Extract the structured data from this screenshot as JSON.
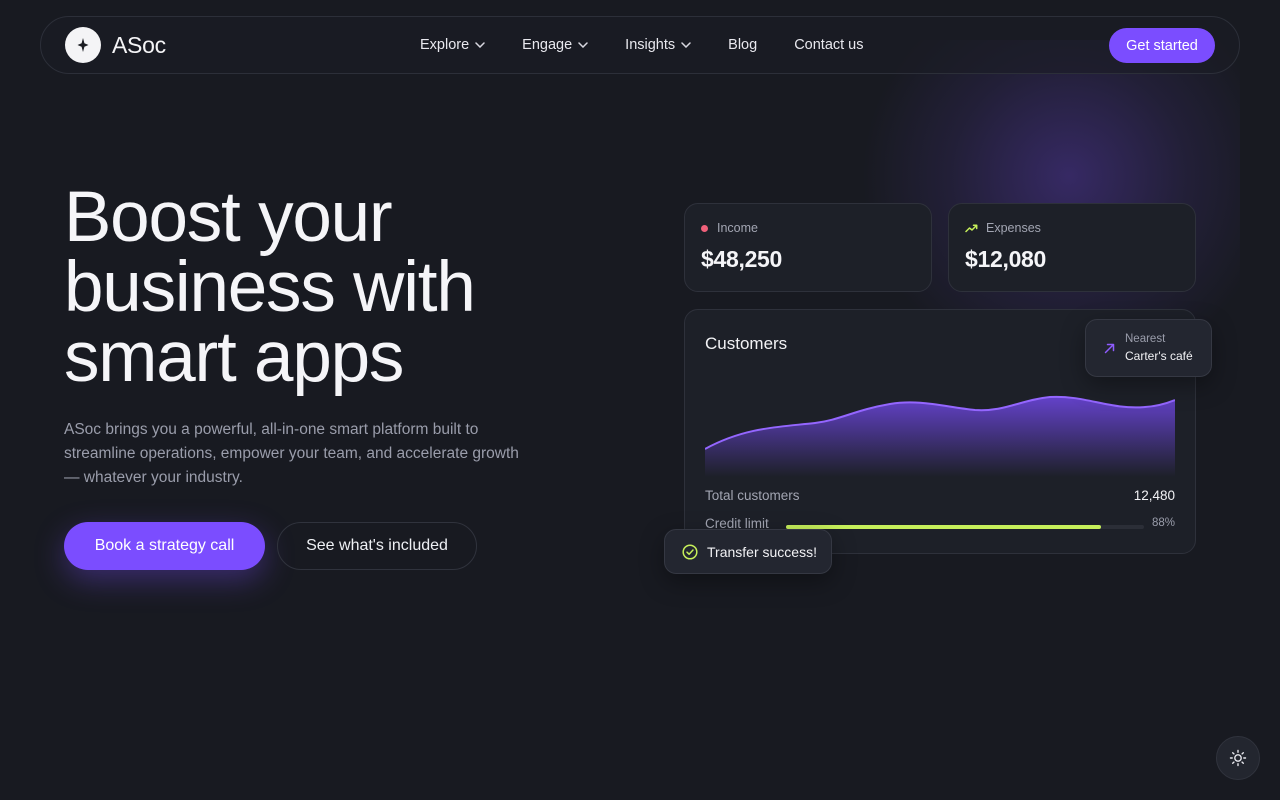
{
  "nav": {
    "brand": "ASoc",
    "links": [
      {
        "label": "Explore",
        "has_dropdown": true
      },
      {
        "label": "Engage",
        "has_dropdown": true
      },
      {
        "label": "Insights",
        "has_dropdown": true
      },
      {
        "label": "Blog",
        "has_dropdown": false
      },
      {
        "label": "Contact us",
        "has_dropdown": false
      }
    ],
    "cta": "Get started"
  },
  "hero": {
    "title_lines": [
      "Boost your",
      "business with",
      "smart apps"
    ],
    "description": "ASoc brings you a powerful, all-in-one smart platform built to streamline operations, empower your team, and accelerate growth — whatever your industry.",
    "primary_button": "Book a strategy call",
    "secondary_button": "See what's included"
  },
  "dashboard": {
    "income": {
      "label": "Income",
      "value": "$48,250"
    },
    "expenses": {
      "label": "Expenses",
      "value": "$12,080"
    },
    "customers": {
      "title": "Customers",
      "total_label": "Total customers",
      "total_value": "12,480",
      "credit_label": "Credit limit",
      "credit_percent_text": "88%",
      "credit_fraction": 0.88
    },
    "nearest": {
      "label": "Nearest",
      "value": "Carter's café"
    },
    "toast": "Transfer success!"
  },
  "colors": {
    "background": "#181a21",
    "accent": "#7b4dff",
    "credit_bar": "#c6ef5a",
    "income_dot": "#f0607a",
    "expense_icon": "#c6ef5a"
  },
  "icons": {
    "logo": "sparkle-icon",
    "dropdown": "chevron-down-icon",
    "expenses": "trend-up-icon",
    "nearest": "arrow-up-right-icon",
    "toast": "check-badge-icon",
    "theme": "sun-icon"
  }
}
